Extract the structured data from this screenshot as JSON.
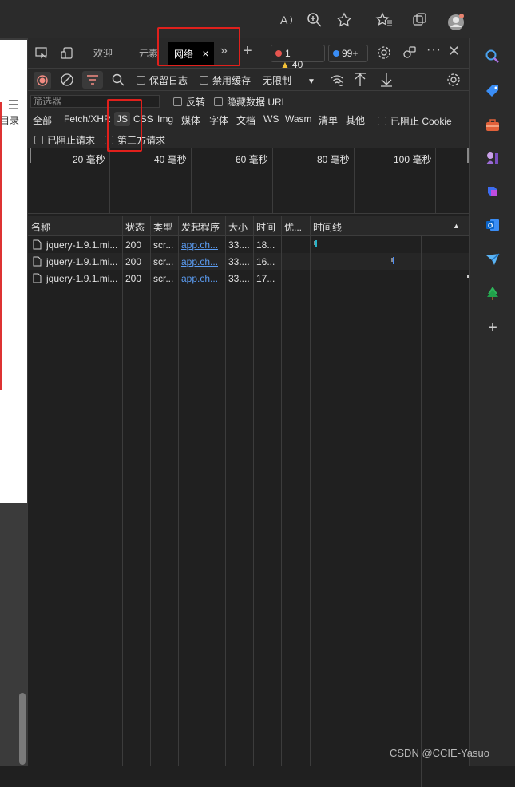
{
  "browser": {
    "toolbar_icons": [
      "read-aloud-icon",
      "zoom-icon",
      "favorite-add-icon",
      "favorites-icon",
      "collections-icon",
      "profile-icon"
    ]
  },
  "page": {
    "toc_label": "目录"
  },
  "devtools": {
    "tabs": {
      "welcome": "欢迎",
      "elements": "元素",
      "network": "网络",
      "close": "×",
      "more": "»",
      "add": "+"
    },
    "badges": {
      "errors": "1",
      "warnings": "40",
      "info": "99+"
    },
    "toolbar": {
      "preserve_log": "保留日志",
      "disable_cache": "禁用缓存",
      "throttle": "无限制"
    },
    "filter": {
      "placeholder": "筛选器",
      "invert": "反转",
      "hide_data_urls": "隐藏数据 URL",
      "types": [
        "全部",
        "Fetch/XHR",
        "JS",
        "CSS",
        "Img",
        "媒体",
        "字体",
        "文档",
        "WS",
        "Wasm",
        "清单",
        "其他"
      ],
      "selected_type": "JS",
      "blocked_cookies": "已阻止 Cookie",
      "blocked_requests": "已阻止请求",
      "third_party": "第三方请求"
    },
    "overview_ticks": [
      "20 毫秒",
      "40 毫秒",
      "60 毫秒",
      "80 毫秒",
      "100 毫秒"
    ],
    "table": {
      "headers": [
        "名称",
        "状态",
        "类型",
        "发起程序",
        "大小",
        "时间",
        "优...",
        "时间线"
      ],
      "rows": [
        {
          "name": "jquery-1.9.1.mi...",
          "status": "200",
          "type": "scr...",
          "initiator": "app.ch...",
          "size": "33....",
          "time": "18..."
        },
        {
          "name": "jquery-1.9.1.mi...",
          "status": "200",
          "type": "scr...",
          "initiator": "app.ch...",
          "size": "33....",
          "time": "16..."
        },
        {
          "name": "jquery-1.9.1.mi...",
          "status": "200",
          "type": "scr...",
          "initiator": "app.ch...",
          "size": "33....",
          "time": "17..."
        }
      ]
    }
  },
  "sidebar": {
    "icons": [
      "search-icon",
      "shopping-tag-icon",
      "tools-icon",
      "games-icon",
      "copilot-icon",
      "outlook-icon",
      "send-icon",
      "tree-icon",
      "add-icon"
    ]
  },
  "watermark": "CSDN @CCIE-Yasuo"
}
